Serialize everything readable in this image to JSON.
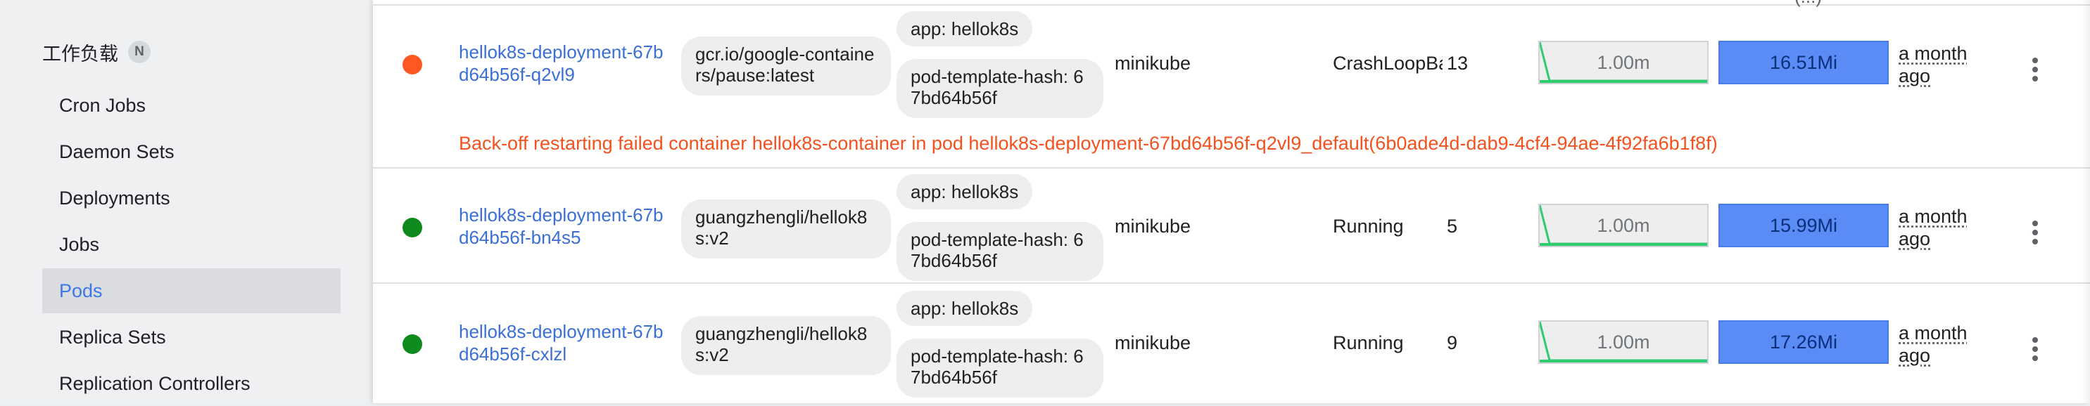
{
  "sidebar": {
    "section_title": "工作负载",
    "section_badge": "N",
    "items": [
      {
        "label": "Cron Jobs"
      },
      {
        "label": "Daemon Sets"
      },
      {
        "label": "Deployments"
      },
      {
        "label": "Jobs"
      },
      {
        "label": "Pods",
        "active": true
      },
      {
        "label": "Replica Sets"
      },
      {
        "label": "Replication Controllers"
      }
    ]
  },
  "pods": {
    "top_fragment": "(...)",
    "rows": [
      {
        "status": "error",
        "status_color": "#ff5722",
        "name": "hellok8s-deployment-67bd64b56f-q2vl9",
        "image": "gcr.io/google-containers/pause:latest",
        "labels": [
          "app: hellok8s",
          "pod-template-hash: 67bd64b56f"
        ],
        "node": "minikube",
        "status_text": "CrashLoopBackOff",
        "restarts": "13",
        "cpu": "1.00m",
        "memory": "16.51Mi",
        "age": "a month ago",
        "error": "Back-off restarting failed container hellok8s-container in pod hellok8s-deployment-67bd64b56f-q2vl9_default(6b0ade4d-dab9-4cf4-94ae-4f92fa6b1f8f)"
      },
      {
        "status": "running",
        "status_color": "#0f8a1f",
        "name": "hellok8s-deployment-67bd64b56f-bn4s5",
        "image": "guangzhengli/hellok8s:v2",
        "labels": [
          "app: hellok8s",
          "pod-template-hash: 67bd64b56f"
        ],
        "node": "minikube",
        "status_text": "Running",
        "restarts": "5",
        "cpu": "1.00m",
        "memory": "15.99Mi",
        "age": "a month ago"
      },
      {
        "status": "running",
        "status_color": "#0f8a1f",
        "name": "hellok8s-deployment-67bd64b56f-cxlzl",
        "image": "guangzhengli/hellok8s:v2",
        "labels": [
          "app: hellok8s",
          "pod-template-hash: 67bd64b56f"
        ],
        "node": "minikube",
        "status_text": "Running",
        "restarts": "9",
        "cpu": "1.00m",
        "memory": "17.26Mi",
        "age": "a month ago"
      }
    ]
  },
  "colors": {
    "link": "#3b6fd8",
    "active_nav": "#3b78e7",
    "error": "#f4511e",
    "sparkline_cpu": "#2ecc71",
    "sparkline_memory": "#5b8cf5"
  },
  "icons": {
    "row_menu": "more-vert-icon"
  }
}
